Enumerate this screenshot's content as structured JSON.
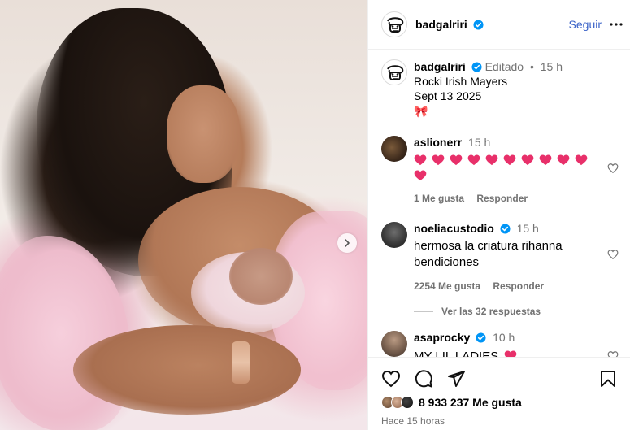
{
  "post_image": {
    "next_icon": "chevron-right-icon"
  },
  "header": {
    "username": "badgalriri",
    "follow_label": "Seguir",
    "more_icon": "more-horizontal-icon"
  },
  "caption": {
    "username": "badgalriri",
    "edited": "Editado",
    "separator": "•",
    "time": "15 h",
    "lines": [
      "Rocki Irish Mayers",
      "Sept 13 2025",
      "🎀"
    ]
  },
  "comments": [
    {
      "username": "aslionerr",
      "time": "15 h",
      "hearts_count": 11,
      "likes_label": "1 Me gusta",
      "reply_label": "Responder"
    },
    {
      "username": "noeliacustodio",
      "time": "15 h",
      "text": "hermosa la criatura rihanna bendiciones",
      "likes_label": "2254 Me gusta",
      "reply_label": "Responder",
      "view_replies": "Ver las 32 respuestas"
    },
    {
      "username": "asaprocky",
      "time": "10 h",
      "text": "MY LIL LADIES"
    }
  ],
  "actions": {
    "likes_text": "8 933 237 Me gusta",
    "time_ago": "Hace 15 horas"
  },
  "colors": {
    "verified": "#0095f6",
    "follow": "#3b63c8",
    "secondary_text": "#737373",
    "heart": "#e8306a"
  }
}
